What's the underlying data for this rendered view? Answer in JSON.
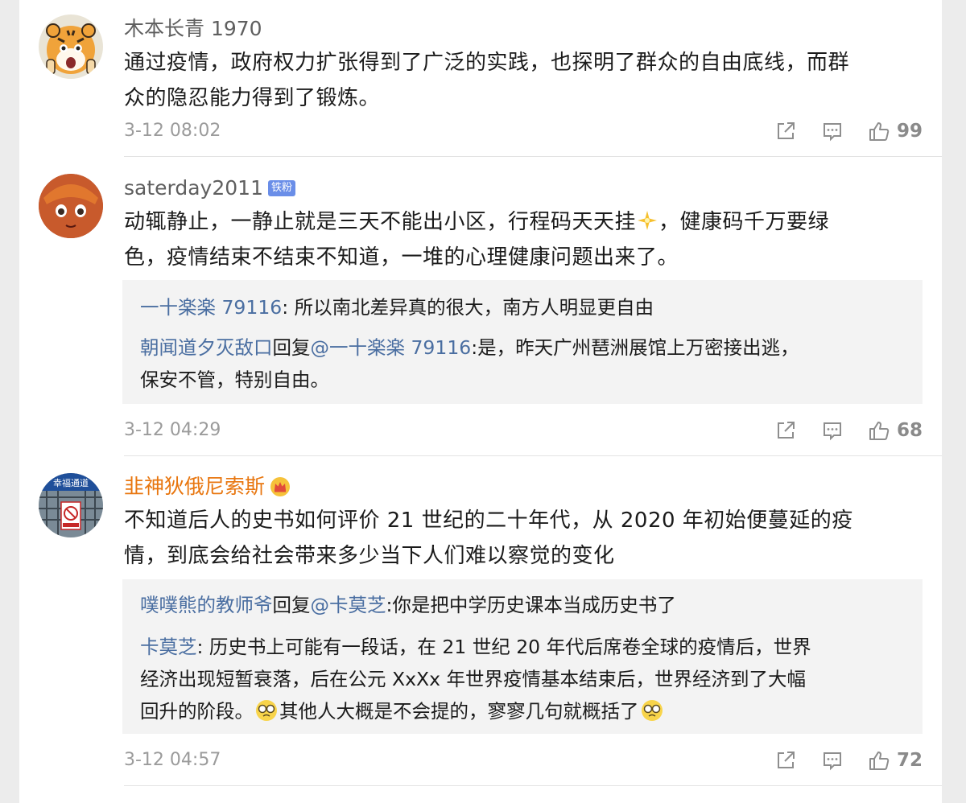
{
  "comments": [
    {
      "username": "木本长青 1970",
      "text_lines": [
        "通过疫情，政府权力扩张得到了广泛的实践，也探明了群众的自由底线，而群",
        "众的隐忍能力得到了锻炼。"
      ],
      "time": "3-12 08:02",
      "likes": "99",
      "avatar_icon": "tiger-cartoon-avatar"
    },
    {
      "username": "saterday2011",
      "badge": "铁粉",
      "text_line1_a": "动辄静止，一静止就是三天不能出小区，行程码天天挂",
      "text_line1_b": "，健康码千万要绿",
      "text_line2": "色，疫情结束不结束不知道，一堆的心理健康问题出来了。",
      "replies": {
        "r1_name": "一十楽楽 79116",
        "r1_text": ": 所以南北差异真的很大，南方人明显更自由",
        "r2_name": "朝闻道夕灭敌口",
        "r2_mid": "回复",
        "r2_target": "@一十楽楽 79116",
        "r2_text": ":是，昨天广州琶洲展馆上万密接出逃，",
        "r2_text2": "保安不管，特别自由。"
      },
      "time": "3-12 04:29",
      "likes": "68",
      "avatar_icon": "anime-face-avatar"
    },
    {
      "username": "韭神狄俄尼索斯",
      "text_lines": [
        "不知道后人的史书如何评价 21 世纪的二十年代，从 2020 年初始便蔓延的疫",
        "情，到底会给社会带来多少当下人们难以察觉的变化"
      ],
      "replies": {
        "r1_name": "噗噗熊的教师爷",
        "r1_mid": "回复",
        "r1_target": "@卡莫芝",
        "r1_text": ":你是把中学历史课本当成历史书了",
        "r2_name": "卡莫芝",
        "r2_text": ": 历史书上可能有一段话，在 21 世纪 20 年代后席卷全球的疫情后，世界",
        "r2_text2": "经济出现短暂衰落，后在公元 XxXx 年世界疫情基本结束后，世界经济到了大幅",
        "r2_text3_a": "回升的阶段。",
        "r2_text3_b": "其他人大概是不会提的，寥寥几句就概括了"
      },
      "time": "3-12 04:57",
      "likes": "72",
      "avatar_text": "幸福通道",
      "avatar_icon": "sign-photo-avatar"
    }
  ],
  "icons": {
    "share": "share-icon",
    "comment": "comment-icon",
    "like": "thumbs-up-icon"
  },
  "colors": {
    "username_gray": "#5f5f5f",
    "username_vip": "#e8760f",
    "reply_name": "#4a6ea1",
    "badge": "#6a8ee8",
    "reply_bg": "#f3f3f3"
  }
}
